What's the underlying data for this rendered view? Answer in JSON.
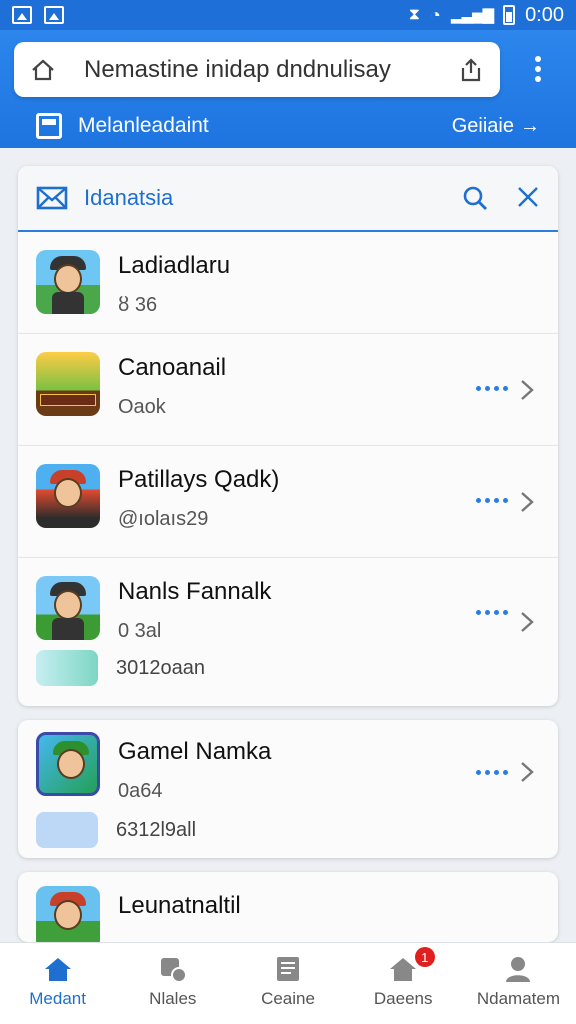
{
  "status_bar": {
    "time": "0:00"
  },
  "address_bar": {
    "url_text": "Nemastine inidap dndnulisay"
  },
  "sub_header": {
    "title": "Melanleadaint",
    "action_label": "Geiiaie"
  },
  "search_panel": {
    "title": "Idanatsia"
  },
  "apps": [
    {
      "name": "Ladiadlaru",
      "meta": "ȣ 36"
    },
    {
      "name": "Canoanail",
      "meta": "Oaok"
    },
    {
      "name": "Patillays Qadk)",
      "meta": "@ıolaıs29"
    },
    {
      "name": "Nanls Fannalk",
      "meta": "0 3al",
      "extra": "3012oaan"
    }
  ],
  "featured": [
    {
      "name": "Gamel Namka",
      "meta": "0a64",
      "extra": "6312l9all"
    },
    {
      "name": "Leunatnaltil"
    }
  ],
  "bottom_nav": {
    "items": [
      {
        "label": "Medant"
      },
      {
        "label": "Nlales"
      },
      {
        "label": "Ceaine"
      },
      {
        "label": "Daeens",
        "badge": "1"
      },
      {
        "label": "Ndamatem"
      }
    ]
  },
  "colors": {
    "primary": "#1e74e0",
    "accent": "#2b7de0",
    "badge": "#e0201e"
  }
}
